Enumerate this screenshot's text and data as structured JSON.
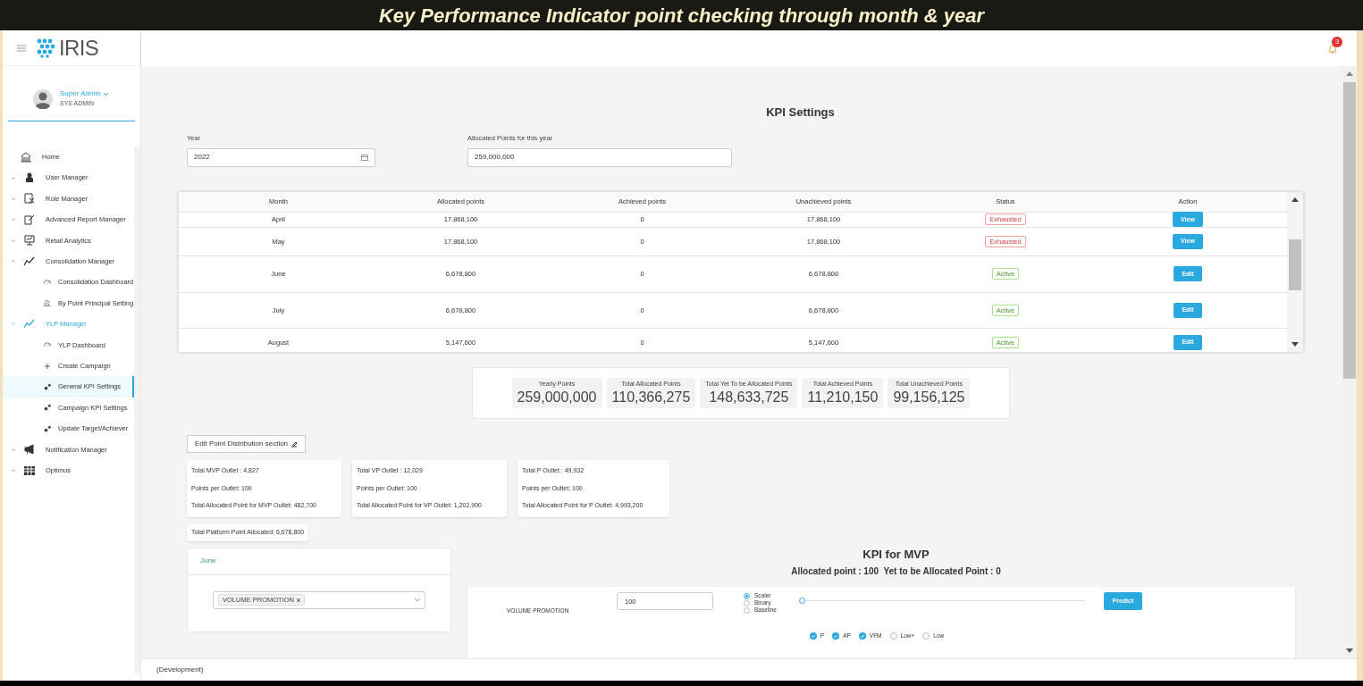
{
  "banner": {
    "title": "Key Performance Indicator point checking through month & year"
  },
  "header": {
    "logo": "IRIS",
    "notification_count": "3"
  },
  "user": {
    "name": "Super Admin",
    "role": "SYS ADMIN"
  },
  "sidebar": {
    "items": [
      {
        "label": "Home",
        "selected": false
      },
      {
        "label": "User Manager",
        "expanded": false,
        "selected": false
      },
      {
        "label": "Role Manager",
        "expanded": false,
        "selected": false
      },
      {
        "label": "Advanced Report Manager",
        "expanded": false,
        "selected": false
      },
      {
        "label": "Retail Analytics",
        "expanded": false,
        "selected": false
      },
      {
        "label": "Consolidation Manager",
        "expanded": true,
        "selected": false,
        "children": [
          {
            "label": "Consolidation Dashboard",
            "selected": false
          },
          {
            "label": "By Point Principal Setting",
            "selected": false
          }
        ]
      },
      {
        "label": "YLP Manager",
        "expanded": true,
        "selected": true,
        "children": [
          {
            "label": "YLP Dashboard",
            "selected": false
          },
          {
            "label": "Create Campaign",
            "selected": false
          },
          {
            "label": "General KPI Settings",
            "selected": true
          },
          {
            "label": "Campaign KPI Settings",
            "selected": false
          },
          {
            "label": "Update Target/Achiever",
            "selected": false
          }
        ]
      },
      {
        "label": "Notification Manager",
        "expanded": false,
        "selected": false
      },
      {
        "label": "Optimus",
        "expanded": false,
        "selected": false
      }
    ]
  },
  "page": {
    "title": "KPI Settings"
  },
  "fields": [
    {
      "label": "Year",
      "value": "2022",
      "kind": "date"
    },
    {
      "label": "Allocated Points for this year",
      "value": "259,000,000",
      "kind": "text"
    }
  ],
  "table": {
    "columns": [
      "Month",
      "Allocated points",
      "Achieved points",
      "Unachieved points",
      "Status",
      "Action"
    ],
    "rows": [
      {
        "month": "April",
        "allocated": "17,868,100",
        "achieved": "0",
        "unachieved": "17,868,100",
        "status": {
          "text": "Exhausted",
          "kind": "exhausted"
        },
        "action": "View"
      },
      {
        "month": "May",
        "allocated": "17,868,100",
        "achieved": "0",
        "unachieved": "17,868,100",
        "status": {
          "text": "Exhausted",
          "kind": "exhausted"
        },
        "action": "View"
      },
      {
        "month": "June",
        "allocated": "6,678,800",
        "achieved": "0",
        "unachieved": "6,678,800",
        "status": {
          "text": "Active",
          "kind": "active"
        },
        "action": "Edit"
      },
      {
        "month": "July",
        "allocated": "6,678,800",
        "achieved": "0",
        "unachieved": "6,678,800",
        "status": {
          "text": "Active",
          "kind": "active"
        },
        "action": "Edit"
      },
      {
        "month": "August",
        "allocated": "5,147,600",
        "achieved": "0",
        "unachieved": "5,147,600",
        "status": {
          "text": "Active",
          "kind": "active"
        },
        "action": "Edit"
      }
    ]
  },
  "summary": [
    {
      "label": "Yearly Points",
      "value": "259,000,000"
    },
    {
      "label": "Total Allocated Points",
      "value": "110,366,275"
    },
    {
      "label": "Total Yet To be Allocated Points",
      "value": "148,633,725"
    },
    {
      "label": "Total Achieved Points",
      "value": "11,210,150"
    },
    {
      "label": "Total Unachieved Points",
      "value": "99,156,125"
    }
  ],
  "edit_button": "Edit Point Distribution section",
  "outlet_cards": [
    {
      "lines": [
        "Total MVP Outlet : 4,827",
        "Points per Outlet: 100",
        "Total Allocated Point for MVP Outlet: 482,700"
      ]
    },
    {
      "lines": [
        "Total VP Outlet : 12,029",
        "Points per Outlet: 100",
        "Total Allocated Point for VP Outlet: 1,202,900"
      ]
    },
    {
      "lines": [
        "Total P Outlet : 49,932",
        "Points per Outlet: 100",
        "Total Allocated Point for P Outlet: 4,993,200"
      ]
    }
  ],
  "platform_total": "Total Platform Point Allocated: 6,678,800",
  "month_panel": {
    "title": "June",
    "tags": [
      "VOLUME PROMOTION"
    ]
  },
  "kpi": {
    "title": "KPI for MVP",
    "subtitle": "Allocated point : 100  Yet to be Allocated Point : 0",
    "rows": [
      {
        "name": "VOLUME PROMOTION",
        "value": "100",
        "level": 0,
        "button": "Predict",
        "options": [
          {
            "label": "Scaler",
            "selected": true
          },
          {
            "label": "Binary",
            "selected": false
          },
          {
            "label": "Baseline",
            "selected": false
          }
        ],
        "segments": [
          {
            "label": "P",
            "checked": true
          },
          {
            "label": "AP",
            "checked": true
          },
          {
            "label": "VFM",
            "checked": true
          },
          {
            "label": "Low+",
            "checked": false
          },
          {
            "label": "Low",
            "checked": false
          }
        ]
      }
    ]
  },
  "footer": "(Development)"
}
